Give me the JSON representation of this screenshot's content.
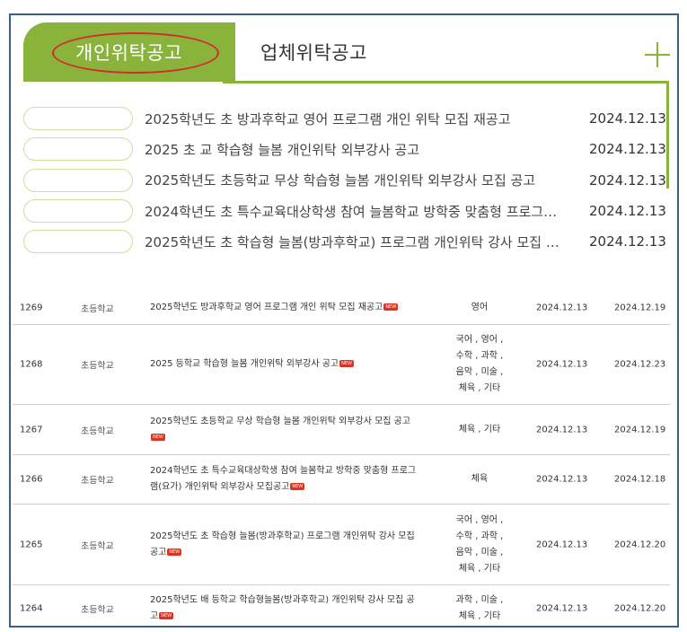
{
  "tabs": {
    "active_label": "개인위탁공고",
    "inactive_label": "업체위탁공고",
    "more_icon": "plus-icon",
    "accent_color": "#8ab33c"
  },
  "notices": [
    {
      "title": "2025학년도 초 방과후학교 영어 프로그램 개인 위탁 모집 재공고",
      "date": "2024.12.13"
    },
    {
      "title": "2025 초 교 학습형 늘봄 개인위탁 외부강사 공고",
      "date": "2024.12.13"
    },
    {
      "title": "2025학년도 초등학교 무상 학습형 늘봄 개인위탁 외부강사 모집 공고",
      "date": "2024.12.13"
    },
    {
      "title": "2024학년도 초 특수교육대상학생 참여 늘봄학교 방학중 맞춤형 프로그…",
      "date": "2024.12.13"
    },
    {
      "title": "2025학년도 초 학습형 늘봄(방과후학교) 프로그램 개인위탁 강사 모집 …",
      "date": "2024.12.13"
    }
  ],
  "table": {
    "new_label": "NEW",
    "rows": [
      {
        "no": "1269",
        "school": "초등학교",
        "title": "2025학년도 방과후학교 영어 프로그램 개인 위탁 모집 재공고",
        "subject": "영어",
        "reg_date": "2024.12.13",
        "end_date": "2024.12.19"
      },
      {
        "no": "1268",
        "school": "초등학교",
        "title": "2025 등학교 학습형 늘봄 개인위탁 외부강사 공고",
        "subject": "국어 , 영어 , 수학 , 과학 , 음악 , 미술 , 체육 , 기타",
        "reg_date": "2024.12.13",
        "end_date": "2024.12.23"
      },
      {
        "no": "1267",
        "school": "초등학교",
        "title": "2025학년도 초등학교 무상 학습형 늘봄 개인위탁 외부강사 모집 공고",
        "subject": "체육 , 기타",
        "reg_date": "2024.12.13",
        "end_date": "2024.12.19"
      },
      {
        "no": "1266",
        "school": "초등학교",
        "title": "2024학년도 초 특수교육대상학생 참여 늘봄학교 방학중 맞춤형 프로그램(요가) 개인위탁 외부강사 모집공고",
        "subject": "체육",
        "reg_date": "2024.12.13",
        "end_date": "2024.12.18"
      },
      {
        "no": "1265",
        "school": "초등학교",
        "title": "2025학년도 초 학습형 늘봄(방과후학교) 프로그램 개인위탁 강사 모집 공고",
        "subject": "국어 , 영어 , 수학 , 과학 , 음악 , 미술 , 체육 , 기타",
        "reg_date": "2024.12.13",
        "end_date": "2024.12.20"
      },
      {
        "no": "1264",
        "school": "초등학교",
        "title": "2025학년도 배 등학교 학습형늘봄(방과후학교) 개인위탁 강사 모집 공고",
        "subject": "과학 , 미술 , 체육 , 기타",
        "reg_date": "2024.12.13",
        "end_date": "2024.12.20"
      }
    ]
  }
}
